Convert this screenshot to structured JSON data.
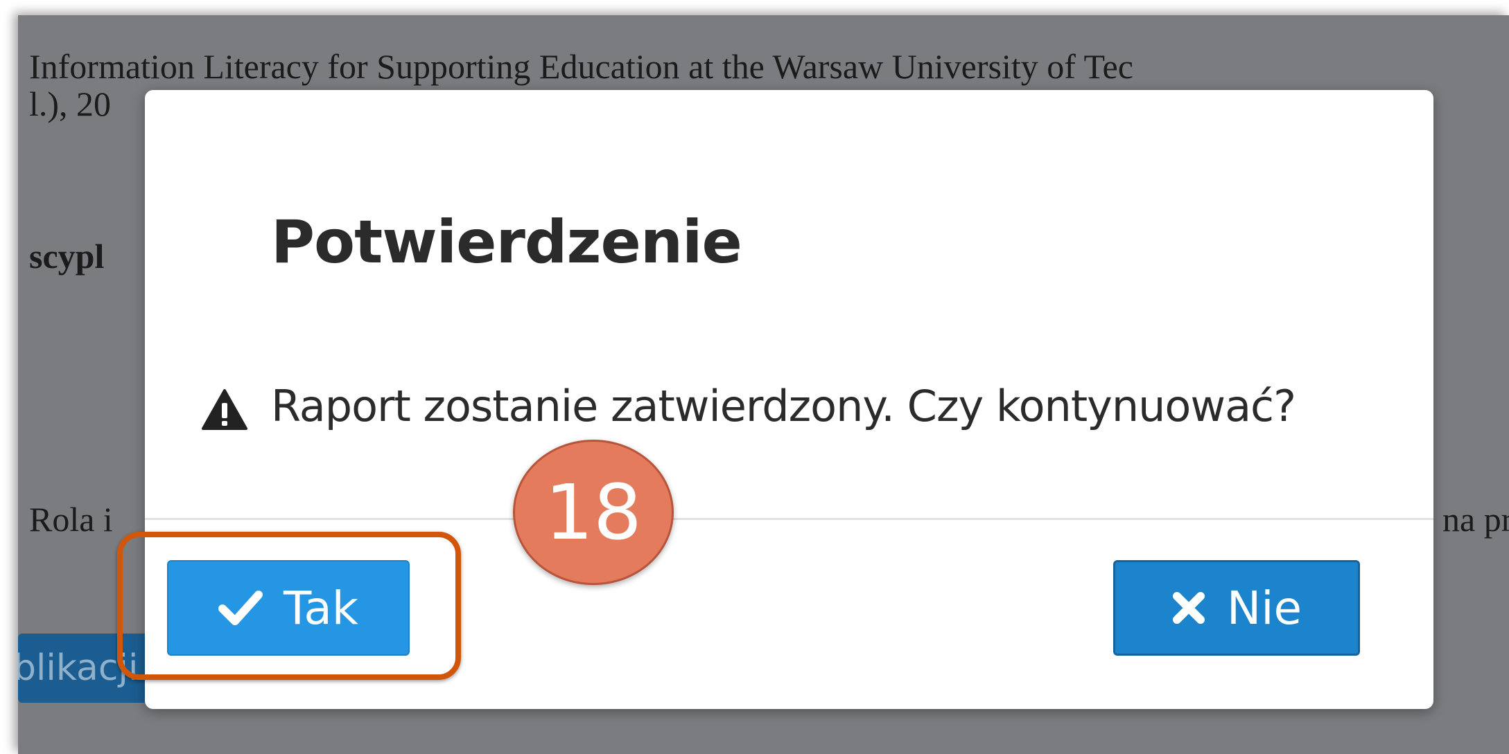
{
  "background": {
    "line1": "Information Literacy for Supporting Education at the Warsaw University of Tec",
    "line2": "l.), 20",
    "line3": "scypl",
    "line4_left": "Rola i",
    "line4_right": "na prz",
    "button_label": "ublikacji"
  },
  "dialog": {
    "title": "Potwierdzenie",
    "icon": "warning-icon",
    "message": "Raport zostanie zatwierdzony. Czy kontynuować?",
    "yes_label": "Tak",
    "yes_icon": "check-icon",
    "no_label": "Nie",
    "no_icon": "close-icon"
  },
  "tutorial": {
    "step_number": "18",
    "highlight_color": "#d1560a",
    "badge_color": "#e47b5c"
  }
}
